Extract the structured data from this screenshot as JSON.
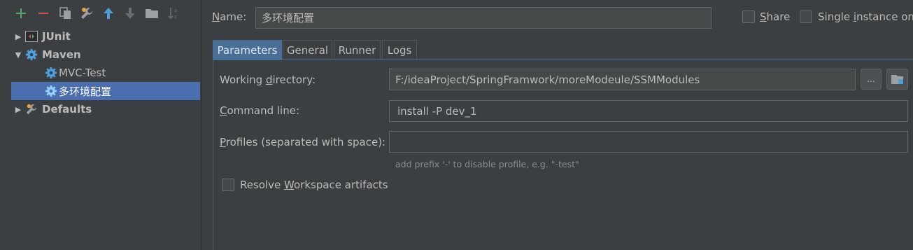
{
  "toolbar": {
    "icons": [
      "add-icon",
      "remove-icon",
      "copy-icon",
      "wrench-icon",
      "move-up-icon",
      "move-down-icon",
      "folder-icon",
      "sort-icon"
    ],
    "colors": {
      "add": "#59a869",
      "remove": "#c75450",
      "move_up": "#4e9fd8"
    }
  },
  "tree": {
    "items": [
      {
        "label": "JUnit",
        "expanded": false,
        "bold": true
      },
      {
        "label": "Maven",
        "expanded": true,
        "bold": true
      },
      {
        "label": "MVC-Test"
      },
      {
        "label": "多环境配置",
        "selected": true
      },
      {
        "label": "Defaults",
        "expanded": false,
        "bold": true
      }
    ]
  },
  "name_row": {
    "label_first": "N",
    "label_rest": "ame:",
    "value": "多环境配置"
  },
  "share": {
    "label_first": "S",
    "label_rest": "hare",
    "checked": false
  },
  "single_instance": {
    "label_start": "Single ",
    "label_u": "i",
    "label_rest": "nstance onl",
    "checked": false
  },
  "tabs": [
    {
      "label": "Parameters",
      "active": true
    },
    {
      "label": "General"
    },
    {
      "label": "Runner"
    },
    {
      "label": "Logs"
    }
  ],
  "params": {
    "working_dir": {
      "label_start": "Working ",
      "label_u": "d",
      "label_rest": "irectory:",
      "value": "F:/ideaProject/SpringFramwork/moreModeule/SSMModules",
      "browse_label": "..."
    },
    "command_line": {
      "label_u": "C",
      "label_rest": "ommand line:",
      "value": "install -P dev_1"
    },
    "profiles": {
      "label_u": "P",
      "label_rest": "rofiles (separated with space):",
      "value": "",
      "hint": "add prefix '-' to disable profile, e.g. \"-test\""
    },
    "resolve": {
      "label_start": "Resolve ",
      "label_u": "W",
      "label_rest": "orkspace artifacts",
      "checked": false
    }
  }
}
